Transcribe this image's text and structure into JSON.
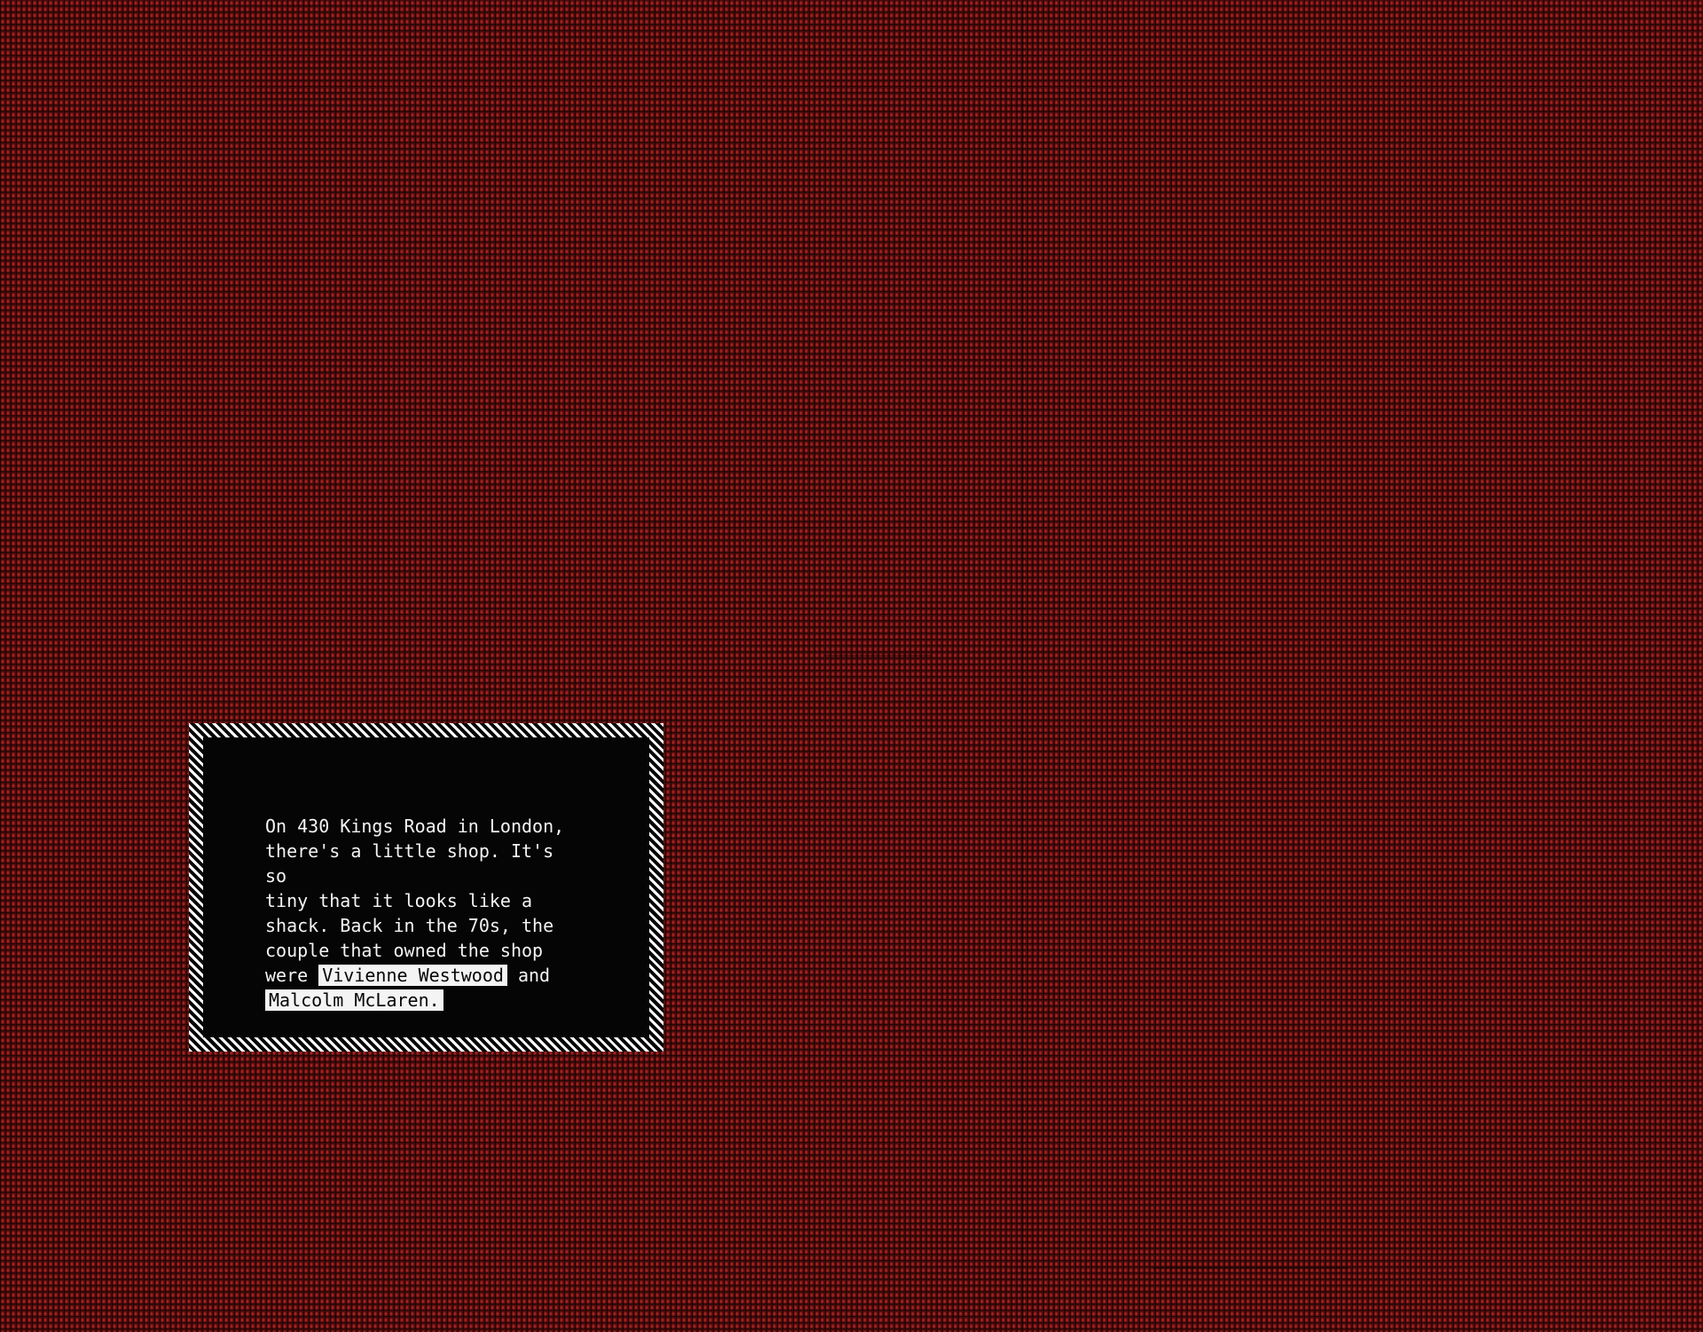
{
  "panel": {
    "background_color": "#4a0b0b",
    "dot_color": "#a3211f",
    "caption": {
      "line1": "On 430 Kings Road in London,",
      "line2": "there's a little shop. It's so",
      "line3": "tiny that it looks like a",
      "line4": "shack. Back in the 70s, the",
      "line5": "couple that owned the shop",
      "line6_prefix": "were",
      "name1": "Vivienne Westwood",
      "line6_suffix": "and",
      "name2": "Malcolm McLaren."
    }
  }
}
